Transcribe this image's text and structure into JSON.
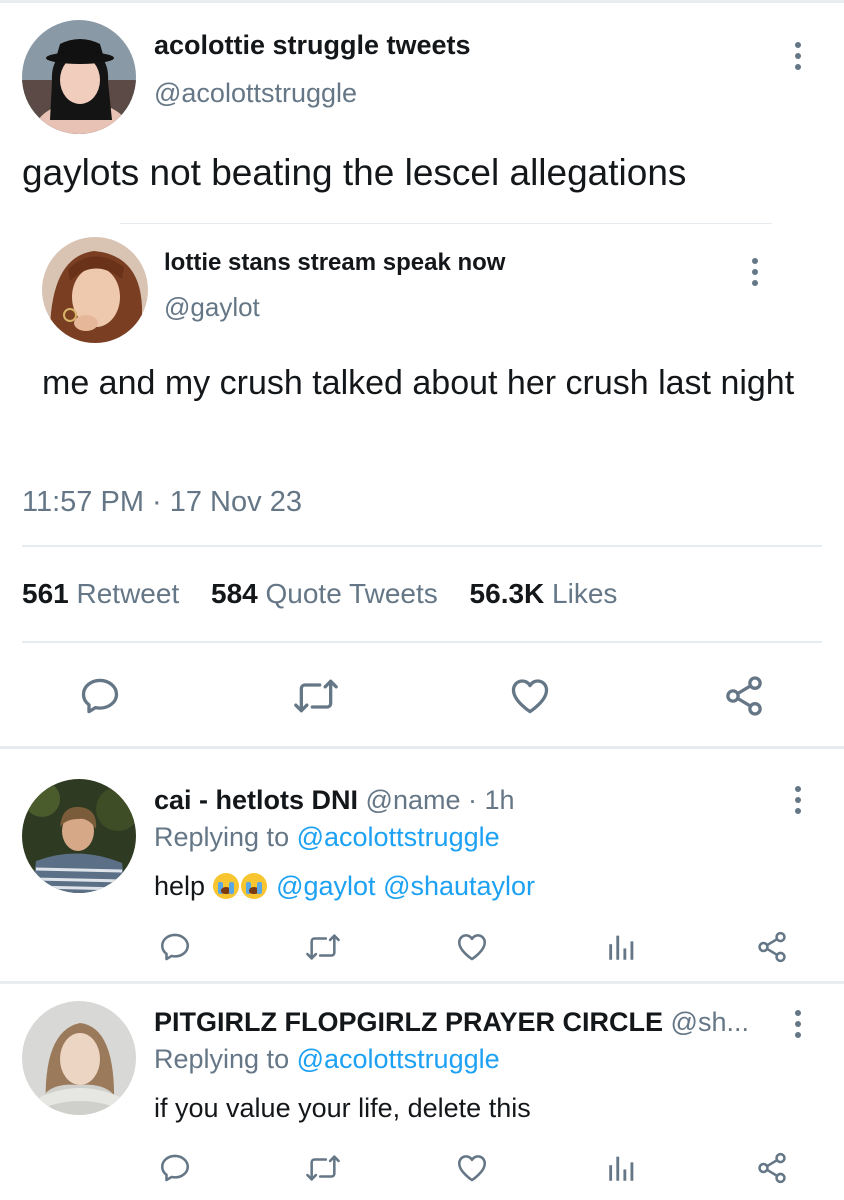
{
  "main_tweet": {
    "display_name": "acolottie struggle tweets",
    "handle": "@acolottstruggle",
    "text": "gaylots not beating the lescel allegations",
    "timestamp": "11:57 PM · 17 Nov 23",
    "stats": {
      "retweets_count": "561",
      "retweets_label": "Retweet",
      "quotes_count": "584",
      "quotes_label": "Quote Tweets",
      "likes_count": "56.3K",
      "likes_label": "Likes"
    }
  },
  "quoted_tweet": {
    "display_name": "lottie stans stream speak now",
    "handle": "@gaylot",
    "text": "me and my crush talked about her crush last night"
  },
  "replies": [
    {
      "display_name": "cai - hetlots DNI",
      "handle_meta": "@name · 1h",
      "replying_prefix": "Replying to",
      "replying_to": "@acolottstruggle",
      "text_before": "help",
      "emoji": [
        "loudly-crying-face",
        "loudly-crying-face"
      ],
      "mention_1": "@gaylot",
      "mention_2": "@shautaylor"
    },
    {
      "display_name": "PITGIRLZ FLOPGIRLZ PRAYER CIRCLE",
      "handle_meta": "@sh...",
      "replying_prefix": "Replying to",
      "replying_to": "@acolottstruggle",
      "text": "if you value your life, delete this"
    }
  ],
  "icons": {
    "reply": "comment-bubble-icon",
    "retweet": "retweet-icon",
    "like": "heart-icon",
    "share": "share-icon",
    "analytics": "analytics-bars-icon",
    "more": "vertical-dots-icon"
  },
  "colors": {
    "text": "#14171a",
    "muted": "#657786",
    "link": "#1da1f2",
    "divider": "#e6ecf0"
  }
}
